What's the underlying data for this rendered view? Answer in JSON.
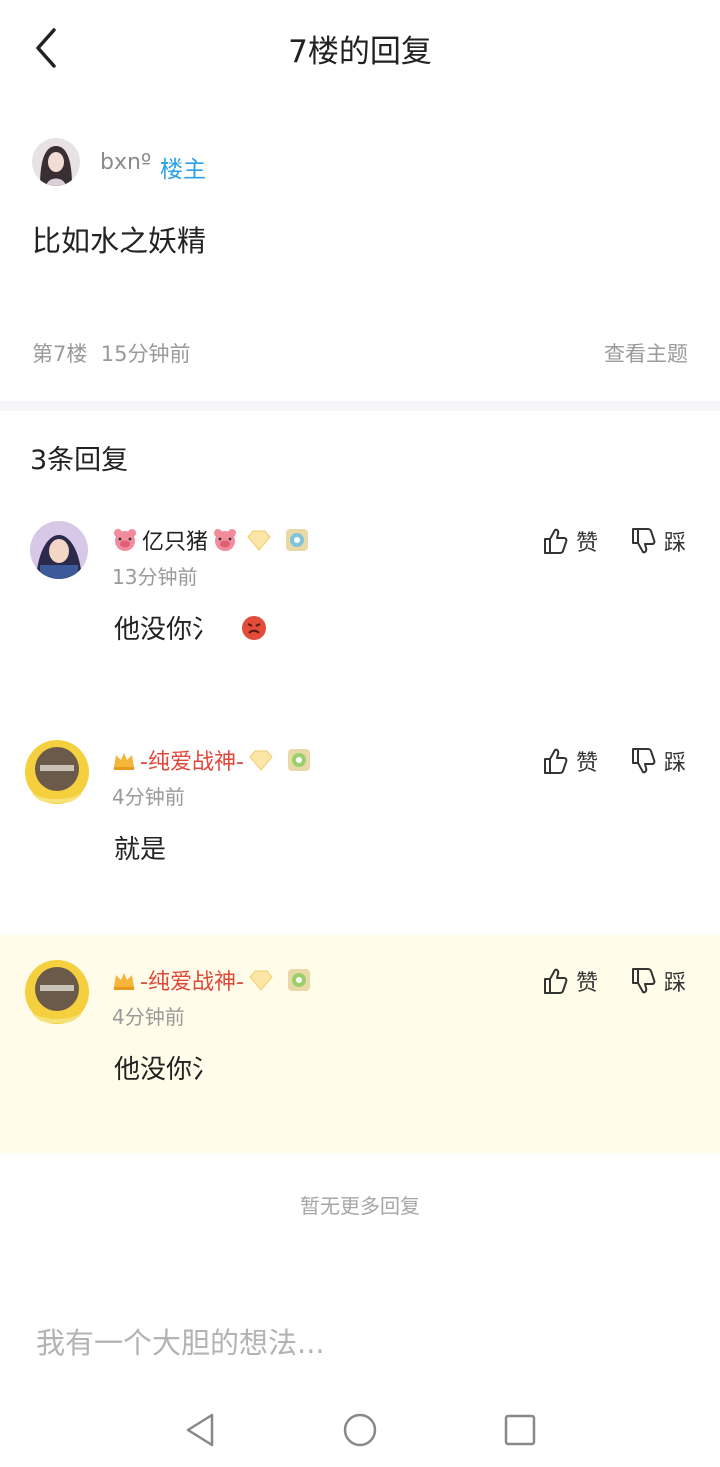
{
  "header": {
    "title": "7楼的回复"
  },
  "post": {
    "author": "bxnº",
    "badge": "楼主",
    "content": "比如水之妖精",
    "floor": "第7楼",
    "time": "15分钟前",
    "view_topic": "查看主题"
  },
  "replies_heading": "3条回复",
  "vote_labels": {
    "like": "赞",
    "dislike": "踩"
  },
  "replies": [
    {
      "name": "亿只猪",
      "time": "13分钟前",
      "content": "他没你氵"
    },
    {
      "name": "-纯爱战神-",
      "time": "4分钟前",
      "content": "就是"
    },
    {
      "name": "-纯爱战神-",
      "time": "4分钟前",
      "content": "他没你氵"
    }
  ],
  "no_more": "暂无更多回复",
  "composer": {
    "placeholder": "我有一个大胆的想法..."
  },
  "colors": {
    "accent_blue": "#2aa0e6",
    "name_red": "#e0483b",
    "highlight_bg": "#fffdea"
  }
}
